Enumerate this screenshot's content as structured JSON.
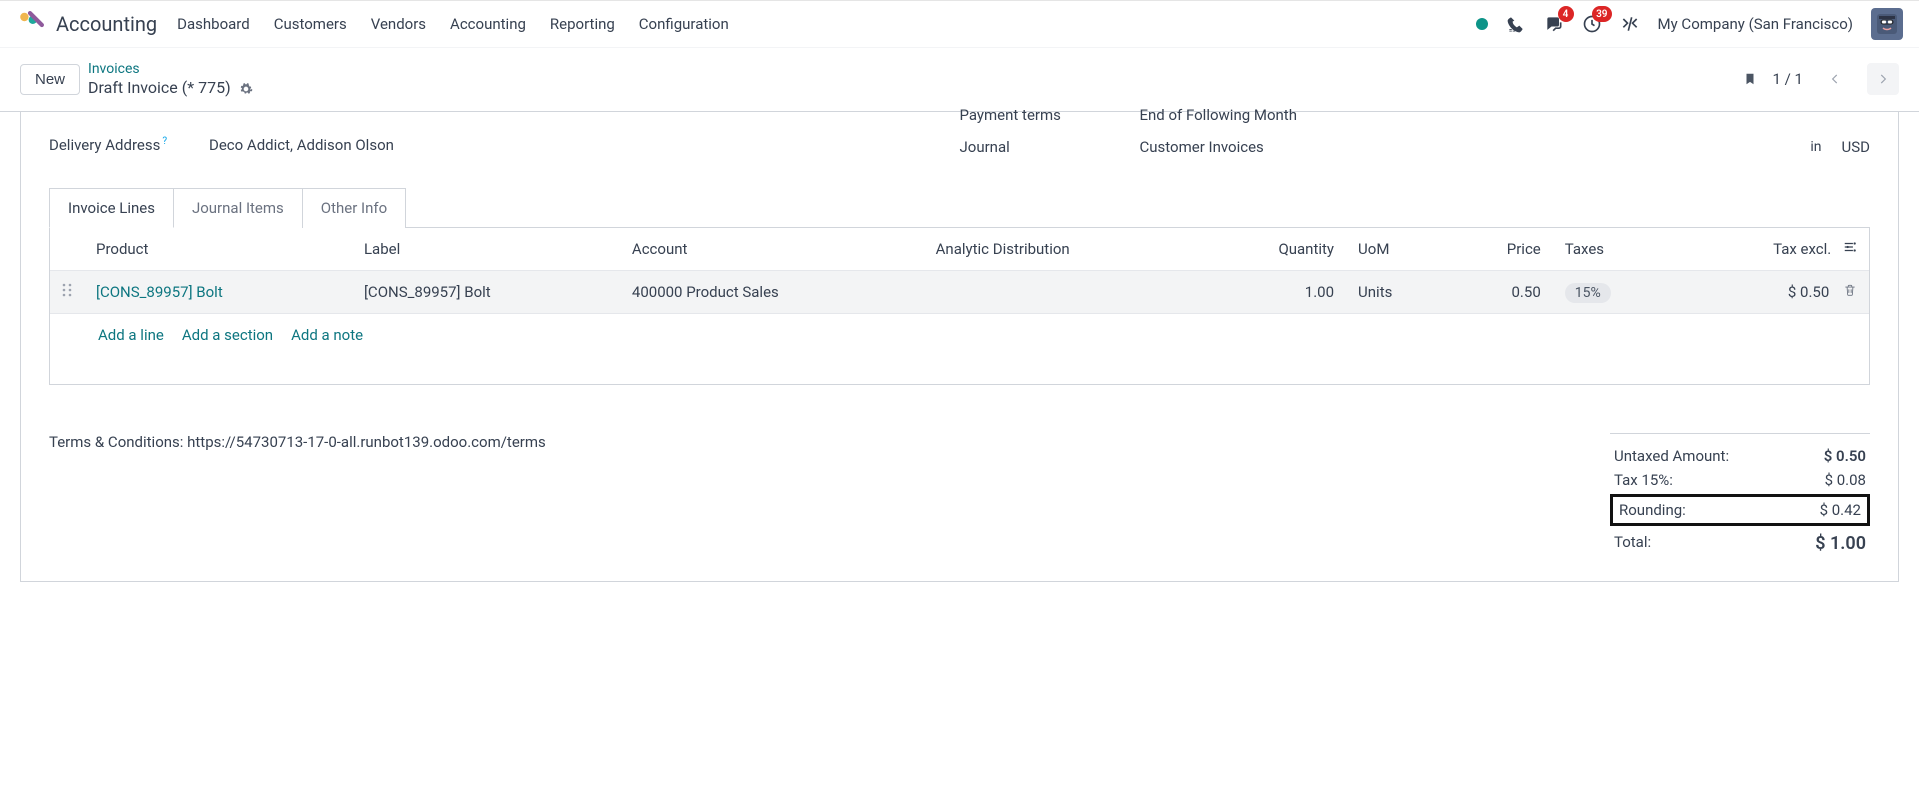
{
  "app": {
    "name": "Accounting"
  },
  "nav": {
    "items": [
      "Dashboard",
      "Customers",
      "Vendors",
      "Accounting",
      "Reporting",
      "Configuration"
    ]
  },
  "topbar": {
    "messages_badge": "4",
    "activities_badge": "39",
    "company": "My Company (San Francisco)"
  },
  "control": {
    "new_label": "New",
    "breadcrumb_parent": "Invoices",
    "breadcrumb_current": "Draft Invoice (* 775)",
    "pager": "1 / 1"
  },
  "fields": {
    "delivery_label": "Delivery Address",
    "delivery_value": "Deco Addict, Addison Olson",
    "payment_terms_label": "Payment terms",
    "payment_terms_value": "End of Following Month",
    "journal_label": "Journal",
    "journal_value": "Customer Invoices",
    "in_label": "in",
    "currency": "USD"
  },
  "tabs": {
    "invoice_lines": "Invoice Lines",
    "journal_items": "Journal Items",
    "other_info": "Other Info"
  },
  "table": {
    "headers": {
      "product": "Product",
      "label": "Label",
      "account": "Account",
      "analytic": "Analytic Distribution",
      "quantity": "Quantity",
      "uom": "UoM",
      "price": "Price",
      "taxes": "Taxes",
      "tax_excl": "Tax excl."
    },
    "row": {
      "product": "[CONS_89957] Bolt",
      "label": "[CONS_89957] Bolt",
      "account": "400000 Product Sales",
      "quantity": "1.00",
      "uom": "Units",
      "price": "0.50",
      "tax": "15%",
      "tax_excl": "$ 0.50"
    },
    "add_line": "Add a line",
    "add_section": "Add a section",
    "add_note": "Add a note"
  },
  "terms": "Terms & Conditions: https://54730713-17-0-all.runbot139.odoo.com/terms",
  "totals": {
    "untaxed_label": "Untaxed Amount:",
    "untaxed_value": "$ 0.50",
    "tax_label": "Tax 15%:",
    "tax_value": "$ 0.08",
    "rounding_label": "Rounding:",
    "rounding_value": "$ 0.42",
    "total_label": "Total:",
    "total_value": "$ 1.00"
  }
}
